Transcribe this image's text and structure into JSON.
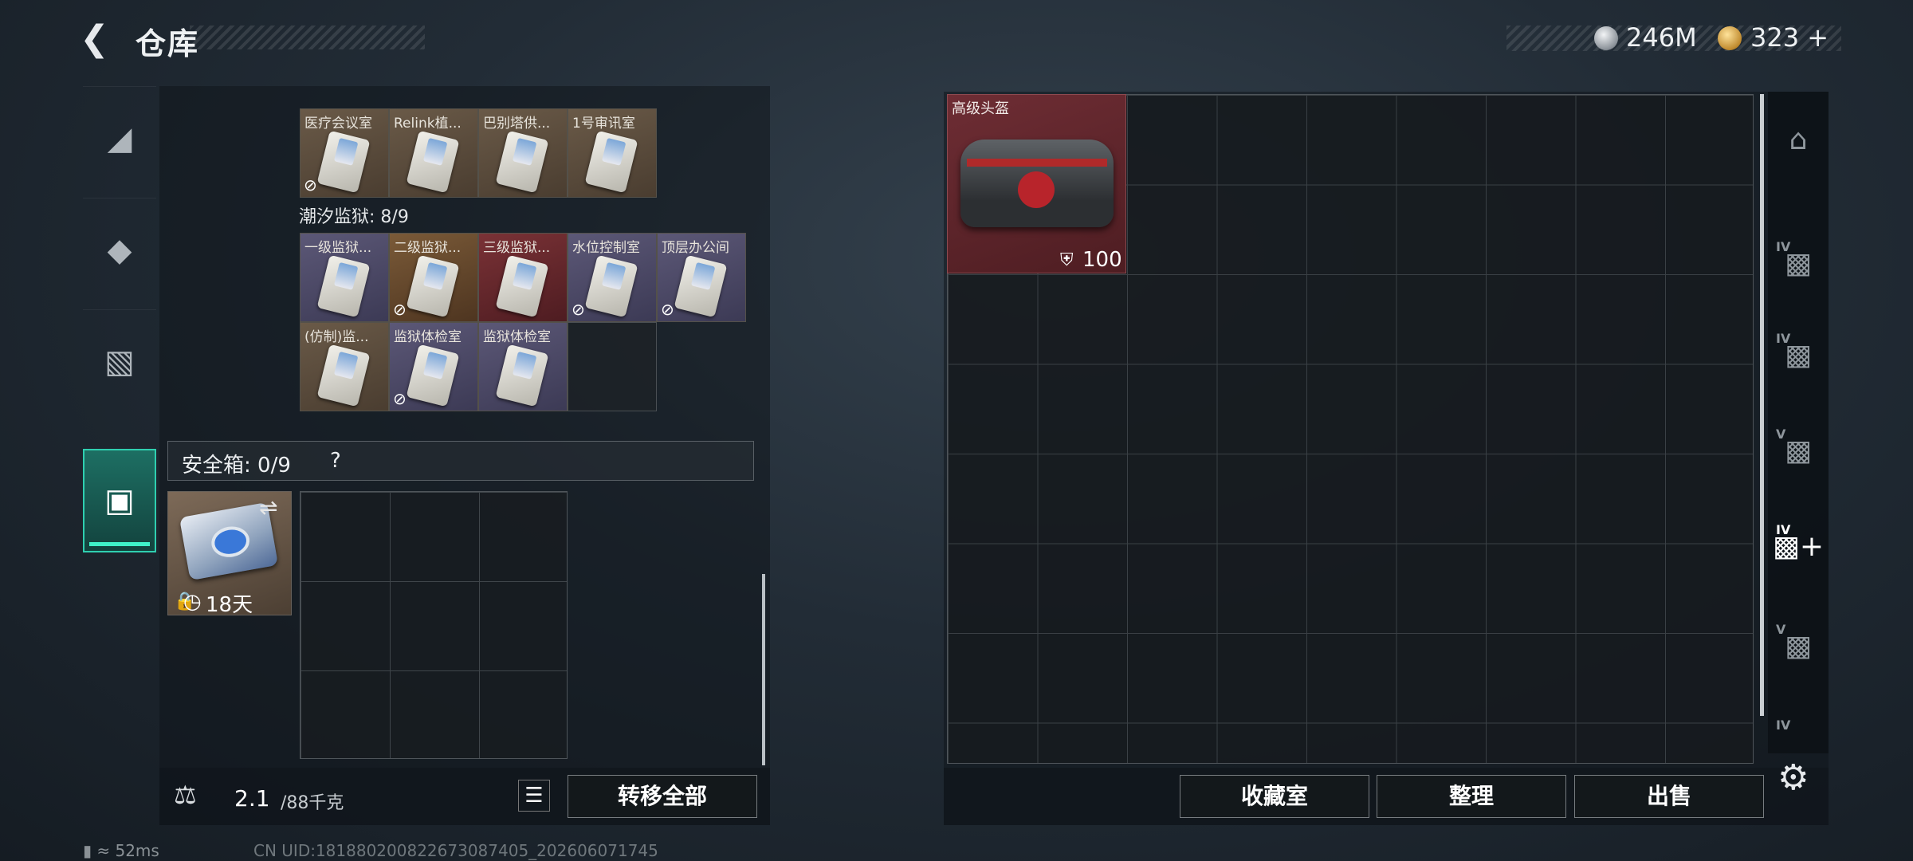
{
  "header": {
    "title": "仓库",
    "currency1": "246M",
    "currency2": "323"
  },
  "keycards_row1": [
    {
      "label": "医疗会议室",
      "color": "brown",
      "locked": true
    },
    {
      "label": "Relink植...",
      "color": "brown",
      "locked": false
    },
    {
      "label": "巴别塔供...",
      "color": "brown",
      "locked": false
    },
    {
      "label": "1号审讯室",
      "color": "brown",
      "locked": false
    }
  ],
  "section": {
    "name": "潮汐监狱: 8/9"
  },
  "keycards_row2": [
    {
      "label": "一级监狱...",
      "color": "purple",
      "locked": false
    },
    {
      "label": "二级监狱...",
      "color": "orange",
      "locked": true
    },
    {
      "label": "三级监狱...",
      "color": "red",
      "locked": false
    },
    {
      "label": "水位控制室",
      "color": "purple",
      "locked": true
    },
    {
      "label": "顶层办公间",
      "color": "purple",
      "locked": true
    }
  ],
  "keycards_row3": [
    {
      "label": "(仿制)监...",
      "color": "brown",
      "locked": false
    },
    {
      "label": "监狱体检室",
      "color": "purple",
      "locked": true
    },
    {
      "label": "监狱体检室",
      "color": "purple",
      "locked": false
    }
  ],
  "safe": {
    "label": "安全箱: 0/9",
    "help": "?",
    "days": "18天"
  },
  "weight": {
    "value": "2.1",
    "capacity": "/88千克"
  },
  "buttons": {
    "transfer": "转移全部",
    "collect": "收藏室",
    "sort": "整理",
    "sell": "出售"
  },
  "item": {
    "name": "高级头盔",
    "durability": "100"
  },
  "sidebar_tiers": [
    "",
    "IV",
    "IV",
    "V",
    "IV",
    "V",
    "IV"
  ],
  "status": {
    "ping": "52ms",
    "uid": "CN UID:18188020082267308740​5_202606071745"
  },
  "colors": {
    "accent": "#3ff2c9",
    "panel": "#161c22"
  }
}
